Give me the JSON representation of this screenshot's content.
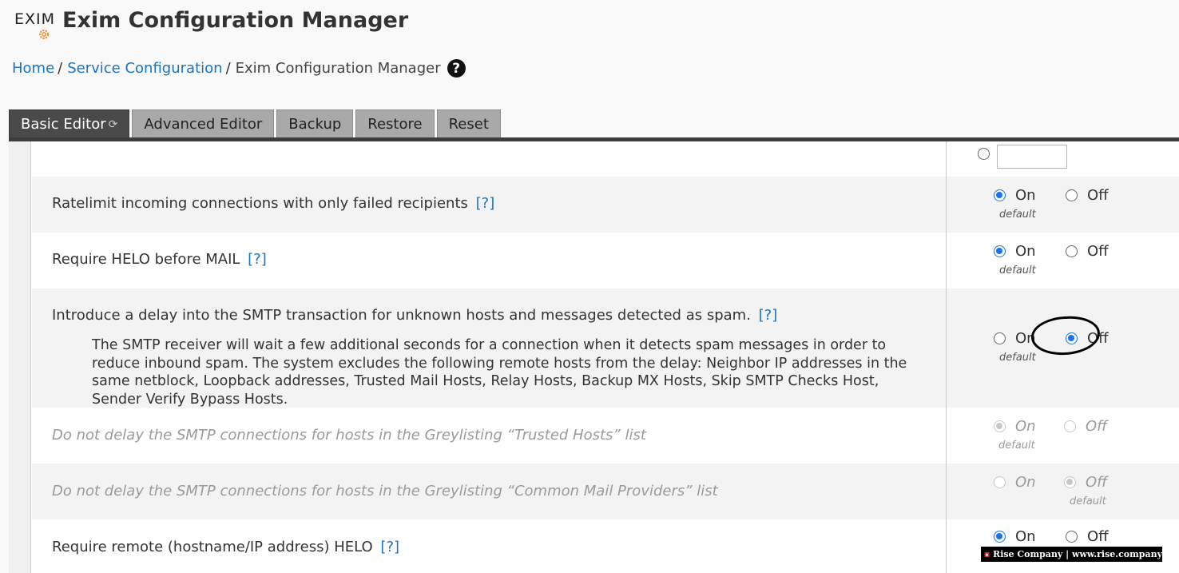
{
  "app": {
    "logo_text": "EXIM",
    "title": "Exim Configuration Manager"
  },
  "breadcrumb": {
    "home": "Home",
    "service_configuration": "Service Configuration",
    "current": "Exim Configuration Manager",
    "help": "?"
  },
  "tabs": [
    {
      "label": "Basic Editor",
      "active": true
    },
    {
      "label": "Advanced Editor",
      "active": false
    },
    {
      "label": "Backup",
      "active": false
    },
    {
      "label": "Restore",
      "active": false
    },
    {
      "label": "Reset",
      "active": false
    }
  ],
  "help_link": "[?]",
  "option_labels": {
    "on": "On",
    "off": "Off",
    "default": "default"
  },
  "settings": [
    {
      "label": "Ratelimit incoming connections with only failed recipients",
      "value": "on",
      "default": "on",
      "disabled": false
    },
    {
      "label": "Require HELO before MAIL",
      "value": "on",
      "default": "on",
      "disabled": false
    },
    {
      "label": "Introduce a delay into the SMTP transaction for unknown hosts and messages detected as spam.",
      "description": "The SMTP receiver will wait a few additional seconds for a connection when it detects spam messages in order to reduce inbound spam. The system excludes the following remote hosts from the delay: Neighbor IP addresses in the same netblock, Loopback addresses, Trusted Mail Hosts, Relay Hosts, Backup MX Hosts, Skip SMTP Checks Host, Sender Verify Bypass Hosts.",
      "value": "off",
      "default": "on",
      "disabled": false
    },
    {
      "label": "Do not delay the SMTP connections for hosts in the Greylisting “Trusted Hosts” list",
      "value": "on",
      "default": "on",
      "disabled": true
    },
    {
      "label": "Do not delay the SMTP connections for hosts in the Greylisting “Common Mail Providers” list",
      "value": "off",
      "default": "off",
      "disabled": true
    },
    {
      "label": "Require remote (hostname/IP address) HELO",
      "value": "on",
      "default": "on",
      "disabled": false
    }
  ],
  "watermark": "Rise Company | www.rise.company",
  "colors": {
    "link": "#1b74bc",
    "radio_checked": "#1a73e8",
    "active_tab": "#4a4a4a",
    "inactive_tab": "#a9a9a9"
  }
}
